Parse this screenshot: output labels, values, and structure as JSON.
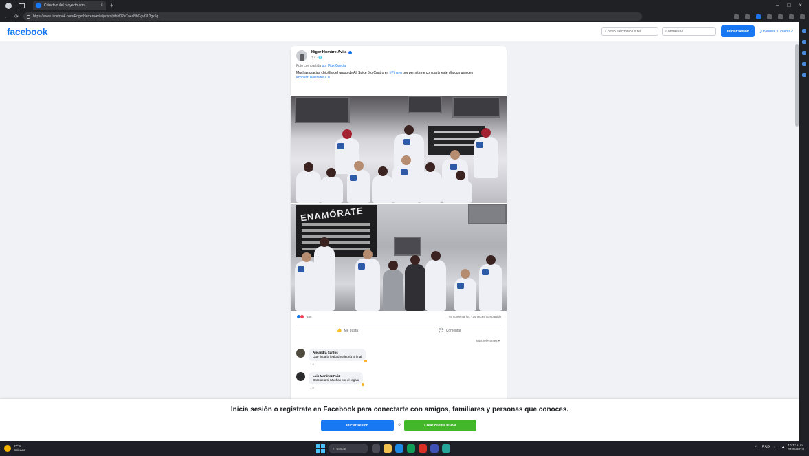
{
  "browser": {
    "tab_title": "Colectivo del proyecto con ...",
    "tab_close": "×",
    "new_tab": "+",
    "url": "https://www.facebook.com/RogerHerreraAvila/posts/pfbid02xCa4sNbGgvt3L3gk5g...",
    "window_controls": [
      "–",
      "□",
      "×"
    ]
  },
  "header": {
    "logo": "facebook",
    "email_placeholder": "Correo electrónico o tel.",
    "password_placeholder": "Contraseña",
    "login_label": "Iniciar sesión",
    "forgot_label": "¿Olvidaste tu cuenta?"
  },
  "post": {
    "author": "Hígor Hombre Ávila",
    "meta": "1 d · 🌐",
    "shared": "Foto compartida",
    "shared_suffix": "por Fiuk García",
    "caption_main": "Muchas gracias chic@s del grupo de All Spice 5to Cuatro en",
    "caption_tag": "#Pinaya",
    "caption_rest": "por permitirme compartir este día con ustedes",
    "caption_hashtag": "#conectITlaUnidosXTi",
    "poster_text": "ENAMÓRATE",
    "reaction_count": "346",
    "comments_shares": "45 comentarios · 24 veces compartido",
    "like_label": "Me gusta",
    "comment_label": "Comentar",
    "relevant_label": "Más relevantes ▾",
    "comments": [
      {
        "name": "Alejandra Santos",
        "text": "Qué linda la lealtad y alegría al final",
        "age": "1 d"
      },
      {
        "name": "Luis Martínez Ruiz",
        "text": "Gracias a ti, Muchas por el regalo",
        "age": "1 d"
      }
    ]
  },
  "banner": {
    "message": "Inicia sesión o regístrate en Facebook para conectarte con amigos, familiares y personas que conoces.",
    "login_label": "Iniciar sesión",
    "or_label": "o",
    "signup_label": "Crear cuenta nueva"
  },
  "taskbar": {
    "weather_temp": "27°C",
    "weather_desc": "Soleado",
    "search_label": "Buscar",
    "time": "10:42 a. m.",
    "date": "27/05/2024",
    "tray_lang": "ESP"
  },
  "colors": {
    "brand": "#1877f2",
    "signup": "#42b72a"
  }
}
